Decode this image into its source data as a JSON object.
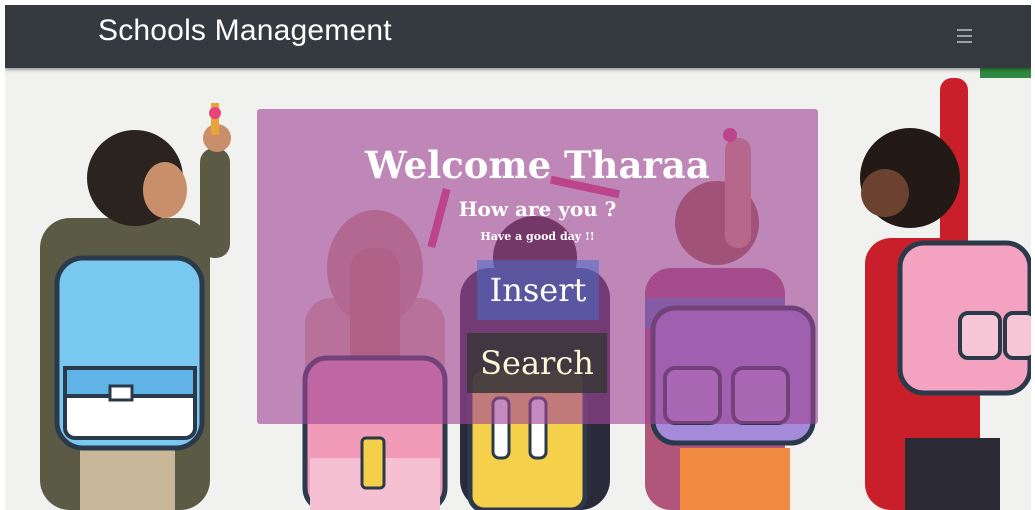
{
  "navbar": {
    "brand": "Schools Management",
    "toggler_icon": "hamburger-icon"
  },
  "hero": {
    "title": "Welcome Tharaa",
    "subtitle": "How are you ?",
    "tagline": "Have a good day !!",
    "insert_label": "Insert",
    "search_label": "Search"
  },
  "colors": {
    "navbar_bg": "#343a40",
    "panel_bg": "#a0469680",
    "insert_bg": "#466ec8",
    "search_bg": "#373737"
  }
}
